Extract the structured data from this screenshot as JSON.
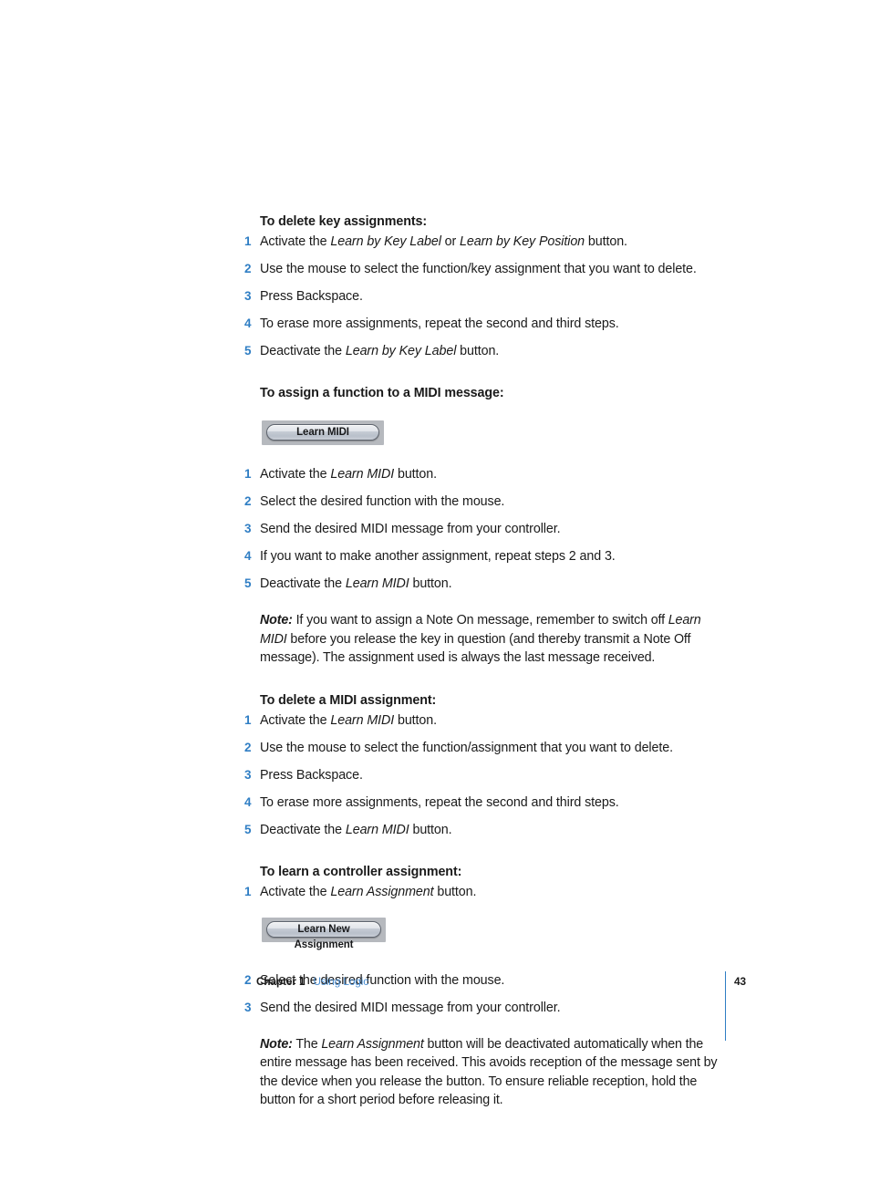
{
  "document": {
    "page_number": "43",
    "footer": {
      "chapter_label": "Chapter 1",
      "doc_title": "Using Logic"
    },
    "accent_blue": "#2f7ec4",
    "link_blue": "#4a8fd4"
  },
  "sections": [
    {
      "id": "delete-key-assignments",
      "heading": "To delete key assignments:",
      "steps": [
        {
          "num": "1",
          "parts": [
            {
              "t": "Activate the ",
              "style": "normal"
            },
            {
              "t": "Learn by Key Label",
              "style": "italic"
            },
            {
              "t": " or ",
              "style": "normal"
            },
            {
              "t": "Learn by Key Position",
              "style": "italic"
            },
            {
              "t": " button.",
              "style": "normal"
            }
          ]
        },
        {
          "num": "2",
          "parts": [
            {
              "t": "Use the mouse to select the function/key assignment that you want to delete.",
              "style": "normal"
            }
          ]
        },
        {
          "num": "3",
          "parts": [
            {
              "t": "Press Backspace.",
              "style": "normal"
            }
          ]
        },
        {
          "num": "4",
          "parts": [
            {
              "t": "To erase more assignments, repeat the second and third steps.",
              "style": "normal"
            }
          ]
        },
        {
          "num": "5",
          "parts": [
            {
              "t": "Deactivate the ",
              "style": "normal"
            },
            {
              "t": "Learn by Key Label",
              "style": "italic"
            },
            {
              "t": " button.",
              "style": "normal"
            }
          ]
        }
      ]
    },
    {
      "id": "assign-function-midi",
      "heading": "To assign a function to a MIDI message:",
      "button": {
        "label": "Learn MIDI",
        "name": "learn-midi-button"
      },
      "steps": [
        {
          "num": "1",
          "parts": [
            {
              "t": "Activate the ",
              "style": "normal"
            },
            {
              "t": "Learn MIDI",
              "style": "italic"
            },
            {
              "t": " button.",
              "style": "normal"
            }
          ]
        },
        {
          "num": "2",
          "parts": [
            {
              "t": "Select the desired function with the mouse.",
              "style": "normal"
            }
          ]
        },
        {
          "num": "3",
          "parts": [
            {
              "t": "Send the desired MIDI message from your controller.",
              "style": "normal"
            }
          ]
        },
        {
          "num": "4",
          "parts": [
            {
              "t": "If you want to make another assignment, repeat steps 2 and 3.",
              "style": "normal"
            }
          ]
        },
        {
          "num": "5",
          "parts": [
            {
              "t": "Deactivate the ",
              "style": "normal"
            },
            {
              "t": "Learn MIDI",
              "style": "italic"
            },
            {
              "t": " button.",
              "style": "normal"
            }
          ]
        }
      ],
      "note": {
        "label": "Note:",
        "parts": [
          {
            "t": " If you want to assign a Note On message, remember to switch off ",
            "style": "normal"
          },
          {
            "t": "Learn MIDI",
            "style": "italic"
          },
          {
            "t": " before you release the key in question (and thereby transmit a Note Off message). The assignment used is always the last message received.",
            "style": "normal"
          }
        ]
      }
    },
    {
      "id": "delete-midi-assignment",
      "heading": "To delete a MIDI assignment:",
      "steps": [
        {
          "num": "1",
          "parts": [
            {
              "t": "Activate the ",
              "style": "normal"
            },
            {
              "t": "Learn MIDI",
              "style": "italic"
            },
            {
              "t": " button.",
              "style": "normal"
            }
          ]
        },
        {
          "num": "2",
          "parts": [
            {
              "t": "Use the mouse to select the function/assignment that you want to delete.",
              "style": "normal"
            }
          ]
        },
        {
          "num": "3",
          "parts": [
            {
              "t": "Press Backspace.",
              "style": "normal"
            }
          ]
        },
        {
          "num": "4",
          "parts": [
            {
              "t": "To erase more assignments, repeat the second and third steps.",
              "style": "normal"
            }
          ]
        },
        {
          "num": "5",
          "parts": [
            {
              "t": "Deactivate the ",
              "style": "normal"
            },
            {
              "t": "Learn MIDI",
              "style": "italic"
            },
            {
              "t": " button.",
              "style": "normal"
            }
          ]
        }
      ]
    },
    {
      "id": "learn-controller-assignment",
      "heading": "To learn a controller assignment:",
      "button": {
        "label": "Learn New Assignment",
        "name": "learn-new-assignment-button"
      },
      "steps_before_button": [
        {
          "num": "1",
          "parts": [
            {
              "t": "Activate the ",
              "style": "normal"
            },
            {
              "t": "Learn Assignment",
              "style": "italic"
            },
            {
              "t": " button.",
              "style": "normal"
            }
          ]
        }
      ],
      "steps_after_button": [
        {
          "num": "2",
          "parts": [
            {
              "t": "Select the desired function with the mouse.",
              "style": "normal"
            }
          ]
        },
        {
          "num": "3",
          "parts": [
            {
              "t": "Send the desired MIDI message from your controller.",
              "style": "normal"
            }
          ]
        }
      ],
      "note": {
        "label": "Note:",
        "parts": [
          {
            "t": " The ",
            "style": "normal"
          },
          {
            "t": "Learn Assignment",
            "style": "italic"
          },
          {
            "t": " button will be deactivated automatically when the entire message has been received. This avoids reception of the message sent by the device when you release the button. To ensure reliable reception, hold the button for a short period before releasing it.",
            "style": "normal"
          }
        ]
      }
    }
  ]
}
